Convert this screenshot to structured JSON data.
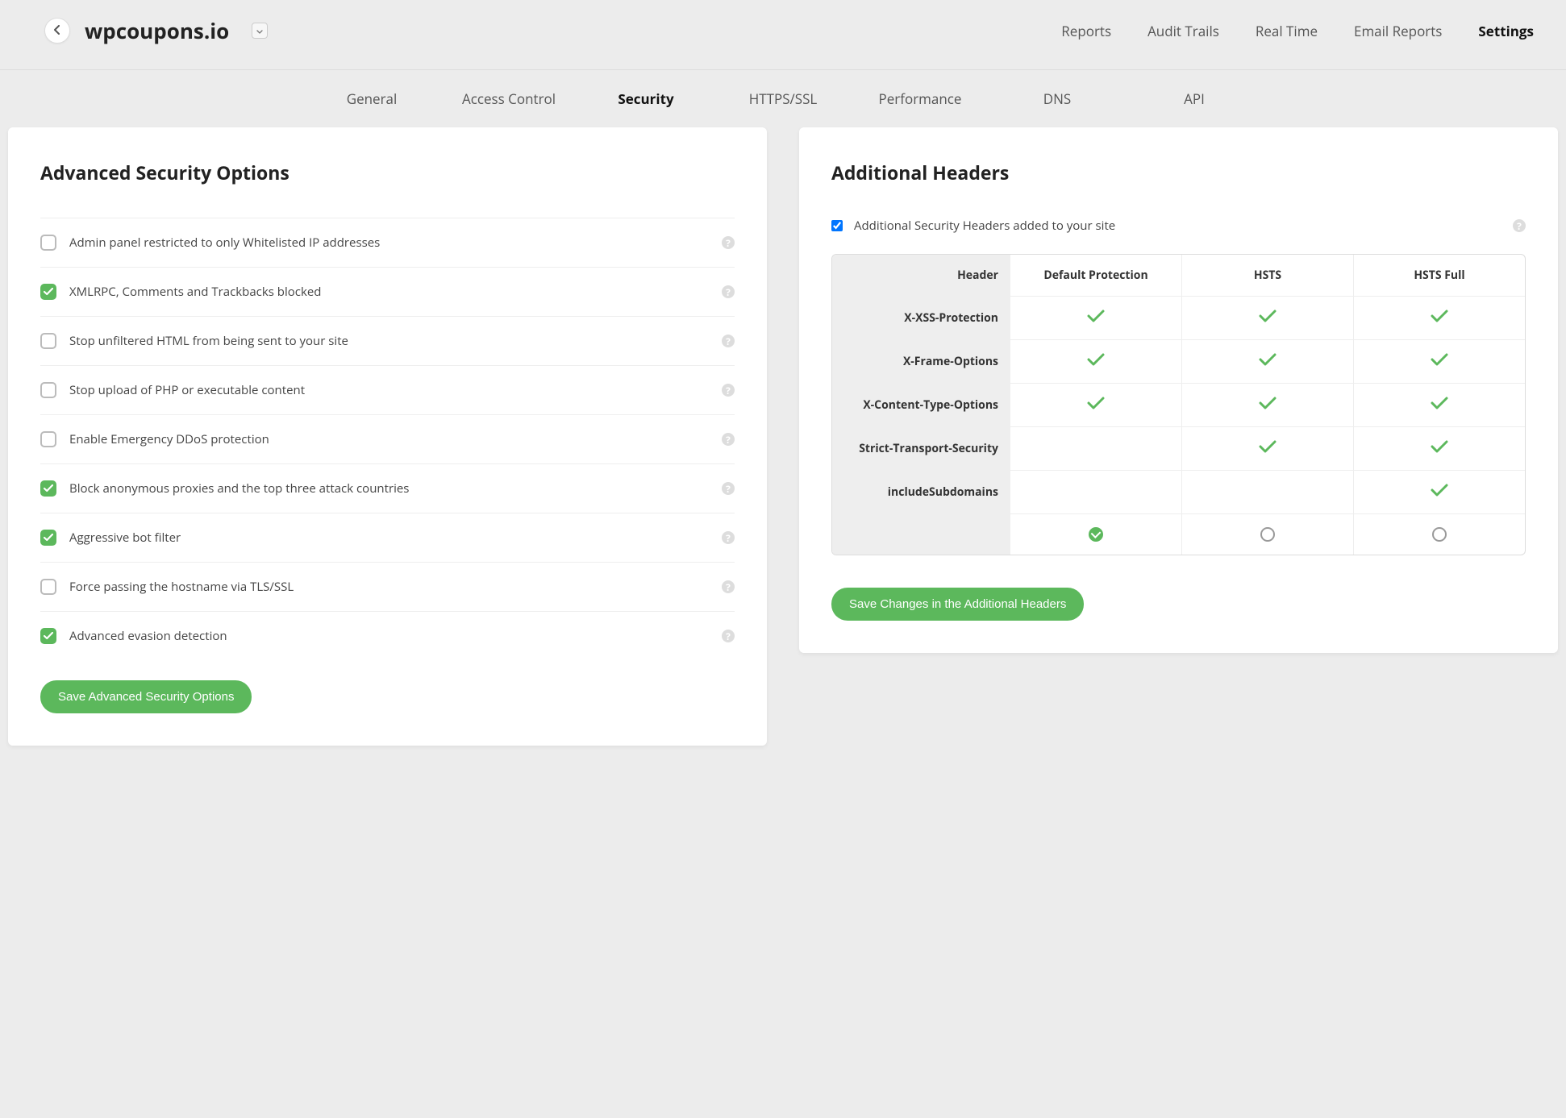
{
  "site_title": "wpcoupons.io",
  "top_nav": {
    "items": [
      {
        "label": "Reports",
        "active": false
      },
      {
        "label": "Audit Trails",
        "active": false
      },
      {
        "label": "Real Time",
        "active": false
      },
      {
        "label": "Email Reports",
        "active": false
      },
      {
        "label": "Settings",
        "active": true
      }
    ]
  },
  "sub_nav": {
    "items": [
      {
        "label": "General",
        "active": false
      },
      {
        "label": "Access Control",
        "active": false
      },
      {
        "label": "Security",
        "active": true
      },
      {
        "label": "HTTPS/SSL",
        "active": false
      },
      {
        "label": "Performance",
        "active": false
      },
      {
        "label": "DNS",
        "active": false
      },
      {
        "label": "API",
        "active": false
      }
    ]
  },
  "left_panel": {
    "title": "Advanced Security Options",
    "options": [
      {
        "label": "Admin panel restricted to only Whitelisted IP addresses",
        "checked": false
      },
      {
        "label": "XMLRPC, Comments and Trackbacks blocked",
        "checked": true
      },
      {
        "label": "Stop unfiltered HTML from being sent to your site",
        "checked": false
      },
      {
        "label": "Stop upload of PHP or executable content",
        "checked": false
      },
      {
        "label": "Enable Emergency DDoS protection",
        "checked": false
      },
      {
        "label": "Block anonymous proxies and the top three attack countries",
        "checked": true
      },
      {
        "label": "Aggressive bot filter",
        "checked": true
      },
      {
        "label": "Force passing the hostname via TLS/SSL",
        "checked": false
      },
      {
        "label": "Advanced evasion detection",
        "checked": true
      }
    ],
    "save_label": "Save Advanced Security Options"
  },
  "right_panel": {
    "title": "Additional Headers",
    "enable_label": "Additional Security Headers added to your site",
    "enable_checked": true,
    "table": {
      "header_col": "Header",
      "columns": [
        "Default Protection",
        "HSTS",
        "HSTS Full"
      ],
      "rows": [
        {
          "name": "X-XSS-Protection",
          "vals": [
            true,
            true,
            true
          ]
        },
        {
          "name": "X-Frame-Options",
          "vals": [
            true,
            true,
            true
          ]
        },
        {
          "name": "X-Content-Type-Options",
          "vals": [
            true,
            true,
            true
          ]
        },
        {
          "name": "Strict-Transport-Security",
          "vals": [
            false,
            true,
            true
          ]
        },
        {
          "name": "includeSubdomains",
          "vals": [
            false,
            false,
            true
          ]
        }
      ],
      "selected_index": 0
    },
    "save_label": "Save Changes in the Additional Headers"
  },
  "help_glyph": "?"
}
